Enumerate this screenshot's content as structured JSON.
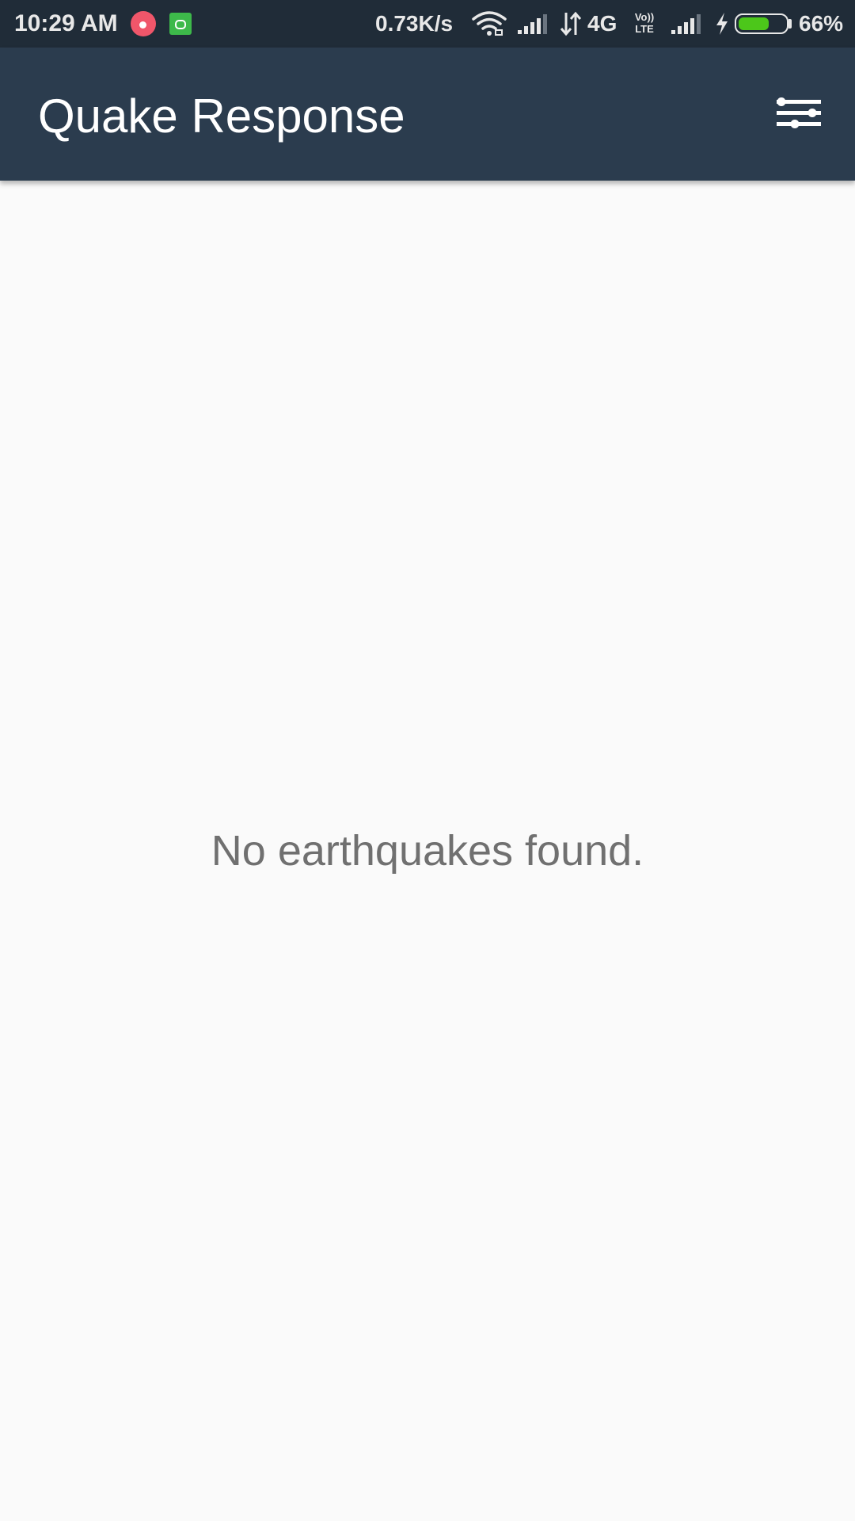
{
  "status_bar": {
    "time": "10:29 AM",
    "network_speed": "0.73K/s",
    "network_type": "4G",
    "volte_top": "Vo))",
    "volte_bottom": "LTE",
    "battery_percent": "66%",
    "battery_level": 0.66,
    "battery_color": "#4cc71a",
    "notification_icons": [
      "music-app-icon",
      "android-app-icon"
    ],
    "system_icons": [
      "wifi-icon",
      "cell-signal-icon",
      "data-arrows-icon",
      "cell-signal-icon",
      "charging-bolt-icon",
      "battery-icon"
    ]
  },
  "app_bar": {
    "title": "Quake Response",
    "background_color": "#2b3c4e",
    "actions": [
      {
        "icon": "filter-sliders-icon",
        "label": ""
      }
    ]
  },
  "content": {
    "empty_message": "No earthquakes found."
  }
}
